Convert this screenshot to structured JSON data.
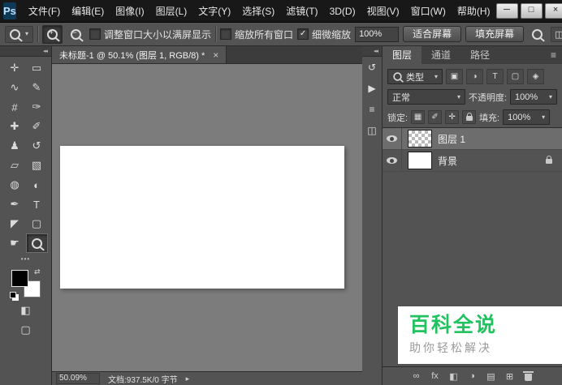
{
  "titlebar": {
    "app": "Ps",
    "menus": [
      "文件(F)",
      "编辑(E)",
      "图像(I)",
      "图层(L)",
      "文字(Y)",
      "选择(S)",
      "滤镜(T)",
      "3D(D)",
      "视图(V)",
      "窗口(W)",
      "帮助(H)"
    ],
    "window_controls": [
      {
        "name": "minimize",
        "glyph": "─"
      },
      {
        "name": "maximize",
        "glyph": "□"
      },
      {
        "name": "close",
        "glyph": "×"
      }
    ]
  },
  "glyphs": {
    "caret": "▾",
    "collapse": "◂◂",
    "menu": "≡",
    "swap": "⇄",
    "arrow_right": "▸"
  },
  "options_bar": {
    "zoom_in_sign": "+",
    "zoom_out_sign": "−",
    "checkboxes": [
      {
        "label": "调整窗口大小以满屏显示",
        "checked": false,
        "mark": ""
      },
      {
        "label": "缩放所有窗口",
        "checked": false,
        "mark": ""
      },
      {
        "label": "细微缩放",
        "checked": true,
        "mark": "✓"
      }
    ],
    "zoom_value": "100%",
    "fit_screen_label": "适合屏幕",
    "fill_screen_label": "填充屏幕"
  },
  "document": {
    "tab_title": "未标题-1 @ 50.1% (图层 1, RGB/8) *",
    "close_glyph": "×"
  },
  "tools": [
    {
      "name": "move-tool",
      "glyph": "✛"
    },
    {
      "name": "marquee-tool",
      "glyph": "▭"
    },
    {
      "name": "lasso-tool",
      "glyph": "∿"
    },
    {
      "name": "quick-selection-tool",
      "glyph": "✎"
    },
    {
      "name": "crop-tool",
      "glyph": "#"
    },
    {
      "name": "eyedropper-tool",
      "glyph": "✑"
    },
    {
      "name": "healing-brush-tool",
      "glyph": "✚"
    },
    {
      "name": "brush-tool",
      "glyph": "✐"
    },
    {
      "name": "clone-stamp-tool",
      "glyph": "♟"
    },
    {
      "name": "history-brush-tool",
      "glyph": "↺"
    },
    {
      "name": "eraser-tool",
      "glyph": "▱"
    },
    {
      "name": "gradient-tool",
      "glyph": "▧"
    },
    {
      "name": "blur-tool",
      "glyph": "◍"
    },
    {
      "name": "dodge-tool",
      "glyph": "◐"
    },
    {
      "name": "pen-tool",
      "glyph": "✒"
    },
    {
      "name": "type-tool",
      "glyph": "T"
    },
    {
      "name": "path-selection-tool",
      "glyph": "◤"
    },
    {
      "name": "shape-tool",
      "glyph": "▢"
    },
    {
      "name": "hand-tool",
      "glyph": "☛"
    },
    {
      "name": "zoom-tool",
      "glyph": "",
      "selected": true
    }
  ],
  "tool_extras": {
    "dots": "•••",
    "quick_mask": "◧",
    "screen_mode": "▢"
  },
  "icon_strip": [
    {
      "name": "history-panel",
      "glyph": "↺"
    },
    {
      "name": "actions-panel",
      "glyph": "▶"
    },
    {
      "name": "properties-panel",
      "glyph": "≡"
    },
    {
      "name": "info-panel",
      "glyph": "◫"
    }
  ],
  "layers_panel": {
    "tabs": [
      "图层",
      "通道",
      "路径"
    ],
    "kind_label": "类型",
    "filter_icons": [
      {
        "name": "filter-pixel-layers",
        "glyph": "▣"
      },
      {
        "name": "filter-adjustment-layers",
        "glyph": "◑"
      },
      {
        "name": "filter-type-layers",
        "glyph": "T"
      },
      {
        "name": "filter-shape-layers",
        "glyph": "▢"
      },
      {
        "name": "filter-smart-objects",
        "glyph": "◈"
      }
    ],
    "blend_mode": "正常",
    "opacity_label": "不透明度:",
    "opacity_value": "100%",
    "lock_label": "锁定:",
    "lock_icons": [
      {
        "name": "lock-transparent-pixels",
        "glyph": "▦"
      },
      {
        "name": "lock-image-pixels",
        "glyph": "✐"
      },
      {
        "name": "lock-position",
        "glyph": "✛"
      }
    ],
    "fill_label": "填充:",
    "fill_value": "100%",
    "layers": [
      {
        "name": "图层 1",
        "selected": true,
        "visible": true,
        "thumb": "checker"
      },
      {
        "name": "背景",
        "selected": false,
        "visible": true,
        "thumb": "white",
        "locked": true
      }
    ],
    "bottom_icons": [
      {
        "name": "link-layers",
        "glyph": "∞"
      },
      {
        "name": "layer-style",
        "glyph": "fx"
      },
      {
        "name": "add-layer-mask",
        "glyph": "◧"
      },
      {
        "name": "new-adjustment-layer",
        "glyph": "◑"
      },
      {
        "name": "new-group",
        "glyph": "▤"
      },
      {
        "name": "new-layer",
        "glyph": "⊞"
      }
    ]
  },
  "status_bar": {
    "zoom": "50.09%",
    "doc_info": "文档:937.5K/0 字节"
  },
  "watermark": {
    "title": "百科全说",
    "subtitle": "助你轻松解决",
    "title_color": "#21c25f",
    "subtitle_color": "#9a9a9a"
  },
  "colors": {
    "panel_bg": "#535353",
    "canvas_bg": "#7c7c7c",
    "titlebar_bg": "#181818"
  }
}
